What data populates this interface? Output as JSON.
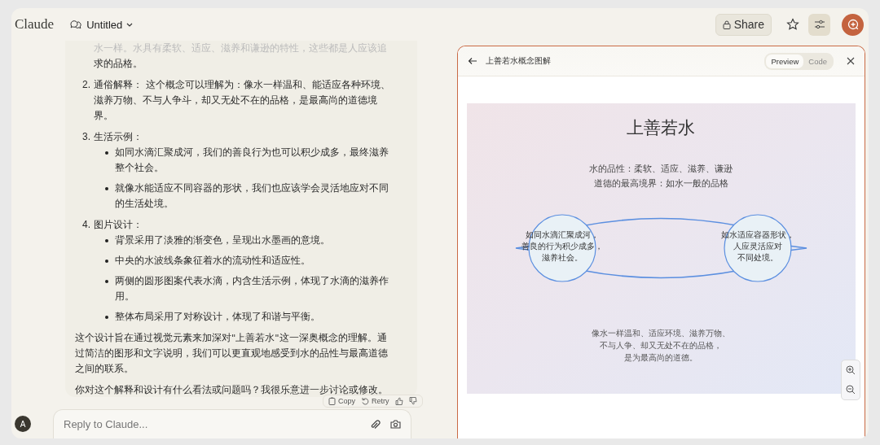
{
  "app": {
    "logo": "Claude",
    "chat_title": "Untitled",
    "share": "Share"
  },
  "message": {
    "fragment": [
      "水一样。水具有柔软、适应、滋养和谦逊的特性，这些都是人应该追",
      "求的品格。"
    ],
    "items": [
      {
        "number": "2.",
        "text": "通俗解释：  这个概念可以理解为：像水一样温和、能适应各种环境、滋养万物、不与人争斗，却又无处不在的品格，是最高尚的道德境界。"
      },
      {
        "number": "3.",
        "text": "生活示例：",
        "bullets": [
          "如同水滴汇聚成河，我们的善良行为也可以积少成多，最终滋养整个社会。",
          "就像水能适应不同容器的形状，我们也应该学会灵活地应对不同的生活处境。"
        ]
      },
      {
        "number": "4.",
        "text": "图片设计：",
        "bullets": [
          "背景采用了淡雅的渐变色，呈现出水墨画的意境。",
          "中央的水波线条象征着水的流动性和适应性。",
          "两侧的圆形图案代表水滴，内含生活示例，体现了水滴的滋养作用。",
          "整体布局采用了对称设计，体现了和谐与平衡。"
        ]
      }
    ],
    "paragraphs": [
      "这个设计旨在通过视觉元素来加深对\"上善若水\"这一深奥概念的理解。通过简洁的图形和文字说明，我们可以更直观地感受到水的品性与最高道德之间的联系。",
      "你对这个解释和设计有什么看法或问题吗？我很乐意进一步讨论或修改。"
    ],
    "actions": {
      "copy": "Copy",
      "retry": "Retry"
    }
  },
  "reply": {
    "avatar": "A",
    "placeholder": "Reply to Claude..."
  },
  "artifact": {
    "title": "上善若水概念图解",
    "tabs": [
      {
        "label": "Preview",
        "selected": true
      },
      {
        "label": "Code",
        "selected": false
      }
    ],
    "heading": "上善若水",
    "subtitle_lines": [
      "水的品性：柔软、适应、滋养、谦逊",
      "道德的最高境界：如水一般的品格"
    ],
    "left_circle": [
      "如同水滴汇聚成河，",
      "善良的行为积少成多，",
      "滋养社会。"
    ],
    "right_circle": [
      "如水适应容器形状，",
      "人应灵活应对",
      "不同处境。"
    ],
    "footer_lines": [
      "像水一样温和、适应环境、滋养万物、",
      "不与人争、却又无处不在的品格，",
      "是为最高尚的道德。"
    ]
  }
}
